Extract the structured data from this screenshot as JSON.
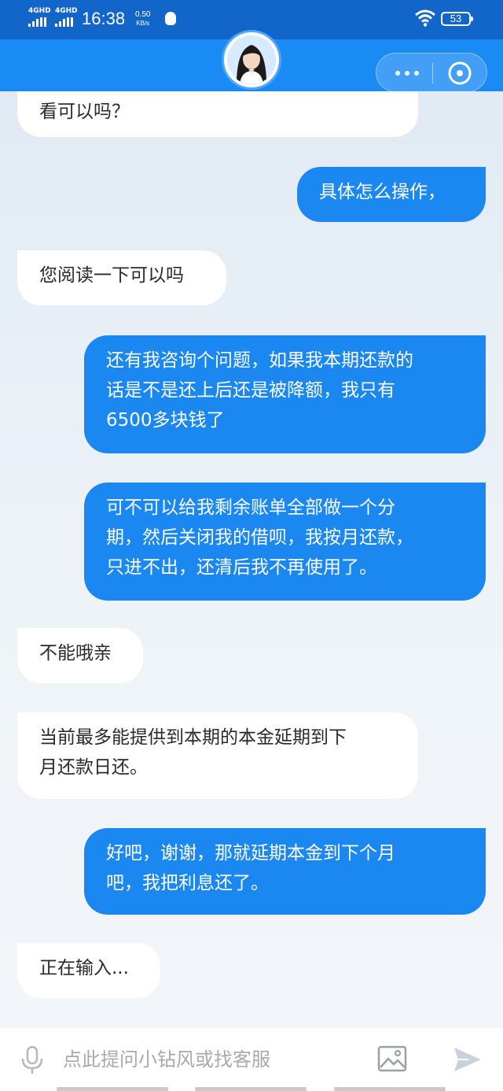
{
  "status_bar": {
    "sim1": "4GHD",
    "sim2": "4GHD",
    "time": "16:38",
    "speed_value": "0.50",
    "speed_unit": "KB/s",
    "battery": "53"
  },
  "header": {
    "avatar_alt": "客服头像",
    "more_icon": "more-dots-icon",
    "close_icon": "close-target-icon"
  },
  "messages": [
    {
      "side": "in",
      "text": "看可以吗？"
    },
    {
      "side": "out",
      "text": "具体怎么操作，"
    },
    {
      "side": "in",
      "text": "您阅读一下可以吗"
    },
    {
      "side": "out",
      "text": "还有我咨询个问题，如果我本期还款的\n话是不是还上后还是被降额，我只有\n6500多块钱了"
    },
    {
      "side": "out",
      "text": "可不可以给我剩余账单全部做一个分\n期，然后关闭我的借呗，我按月还款，\n只进不出，还清后我不再使用了。"
    },
    {
      "side": "in",
      "text": "不能哦亲"
    },
    {
      "side": "in",
      "text": "当前最多能提供到本期的本金延期到下\n月还款日还。"
    },
    {
      "side": "out",
      "text": "好吧，谢谢，那就延期本金到下个月\n吧，我把利息还了。"
    },
    {
      "side": "in",
      "text": "正在输入..."
    }
  ],
  "input_bar": {
    "placeholder": "点此提问小钻风或找客服",
    "mic_icon": "microphone-icon",
    "image_icon": "image-icon",
    "send_icon": "send-icon"
  },
  "colors": {
    "status_bar": "#1266c9",
    "header": "#1a8af5",
    "bubble_out": "#1a88f0",
    "bubble_in": "#ffffff"
  }
}
